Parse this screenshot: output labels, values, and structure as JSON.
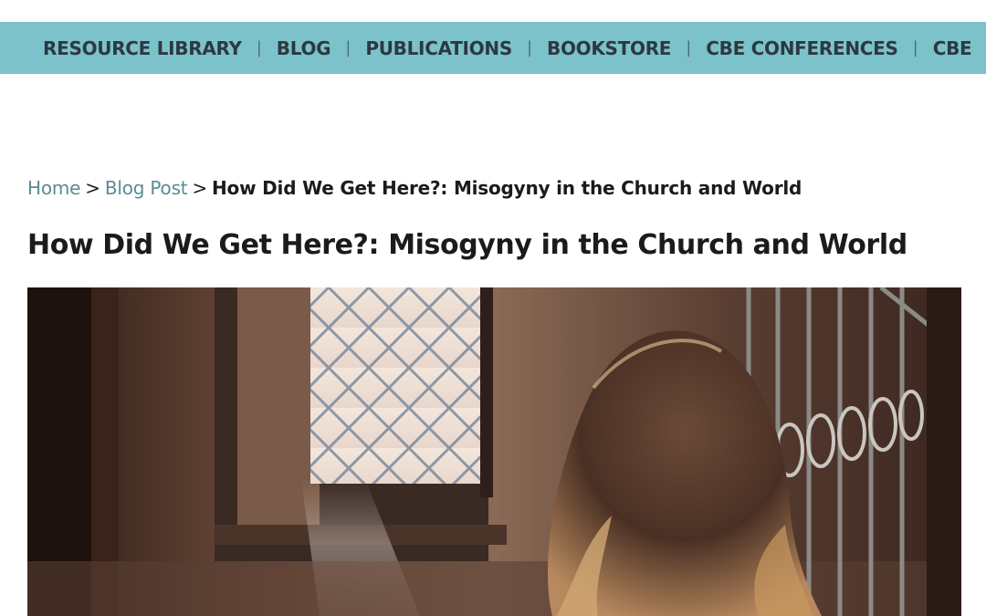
{
  "nav": {
    "items": [
      {
        "label": "RESOURCE LIBRARY"
      },
      {
        "label": "BLOG"
      },
      {
        "label": "PUBLICATIONS"
      },
      {
        "label": "BOOKSTORE"
      },
      {
        "label": "CBE CONFERENCES"
      },
      {
        "label": "CBE"
      }
    ],
    "separator": "|"
  },
  "breadcrumb": {
    "home": "Home",
    "section": "Blog Post",
    "separator": ">",
    "current": "How Did We Get Here?: Misogyny in the Church and World"
  },
  "page": {
    "title": "How Did We Get Here?: Misogyny in the Church and World"
  },
  "hero": {
    "image": "woman-by-window-photo"
  },
  "colors": {
    "nav_bg": "#7cc2cb",
    "nav_text": "#2b3a40",
    "link": "#5a8c93",
    "text": "#1b1b1b"
  }
}
